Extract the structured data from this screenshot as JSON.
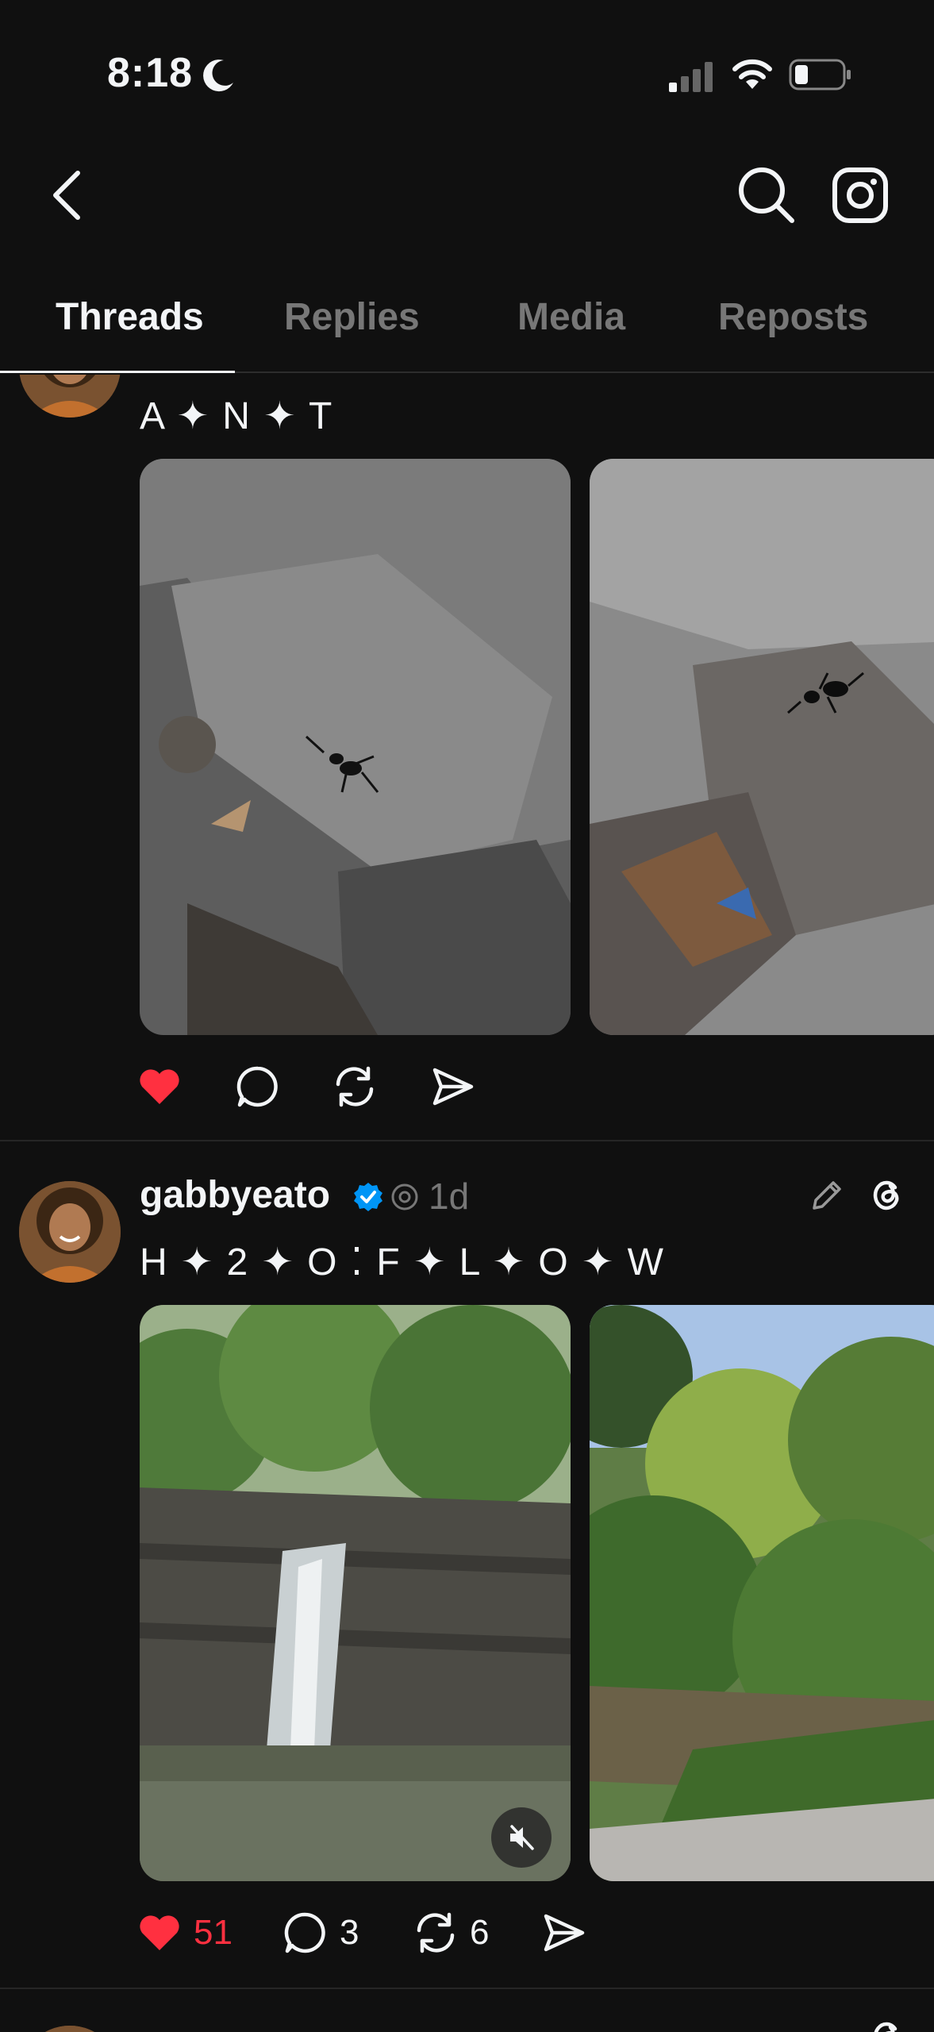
{
  "status_bar": {
    "time": "8:18"
  },
  "tabs": [
    {
      "label": "Threads",
      "active": true
    },
    {
      "label": "Replies",
      "active": false
    },
    {
      "label": "Media",
      "active": false
    },
    {
      "label": "Reposts",
      "active": false
    }
  ],
  "posts": [
    {
      "text": "A ✦ N ✦ T",
      "liked": true,
      "images": [
        "ant-on-rock-photo",
        "ant-on-rock-closeup-photo"
      ]
    },
    {
      "username": "gabbyeato",
      "verified": true,
      "time_ago": "1d",
      "text": "H ✦ 2 ✦ O ⁚ F ✦ L ✦ O ✦ W",
      "images": [
        "waterfall-photo",
        "creek-forest-photo"
      ],
      "likes": "51",
      "replies": "3",
      "reposts": "6",
      "liked": true
    }
  ],
  "colors": {
    "background": "#101010",
    "like_red": "#ff3040",
    "verified_blue": "#0095f6"
  }
}
